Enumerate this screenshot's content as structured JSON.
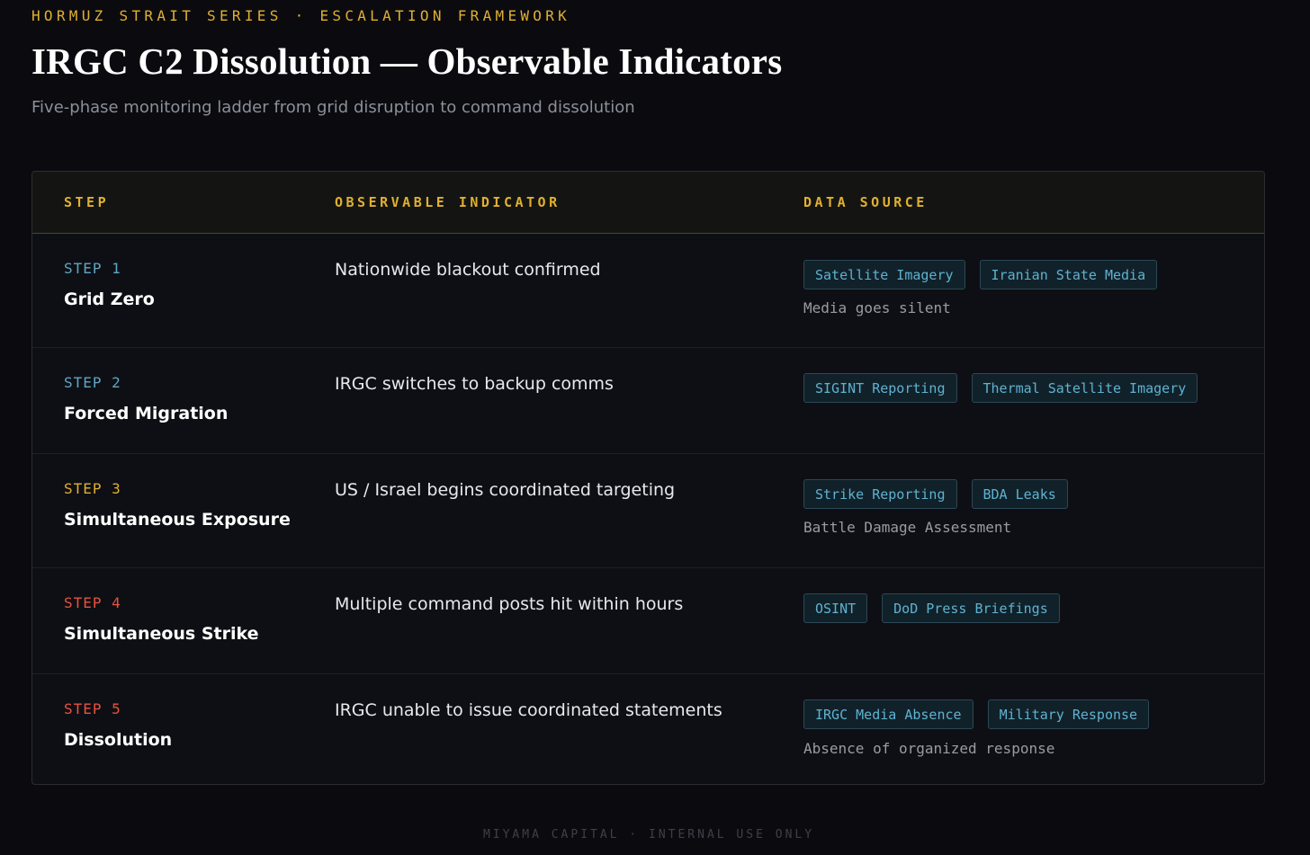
{
  "header": {
    "kicker": "HORMUZ STRAIT SERIES · ESCALATION FRAMEWORK",
    "title": "IRGC C2 Dissolution — Observable Indicators",
    "subtitle": "Five-phase monitoring ladder from grid disruption to command dissolution"
  },
  "table": {
    "columns": [
      "STEP",
      "OBSERVABLE INDICATOR",
      "DATA SOURCE"
    ],
    "rows": [
      {
        "step_label": "STEP 1",
        "step_color": "#5ea7c6",
        "step_name": "Grid Zero",
        "indicator": "Nationwide blackout confirmed",
        "sources": [
          "Satellite Imagery",
          "Iranian State Media"
        ],
        "note": "Media goes silent"
      },
      {
        "step_label": "STEP 2",
        "step_color": "#5ea7c6",
        "step_name": "Forced Migration",
        "indicator": "IRGC switches to backup comms",
        "sources": [
          "SIGINT Reporting",
          "Thermal Satellite Imagery"
        ],
        "note": ""
      },
      {
        "step_label": "STEP 3",
        "step_color": "#e0b030",
        "step_name": "Simultaneous Exposure",
        "indicator": "US / Israel begins coordinated targeting",
        "sources": [
          "Strike Reporting",
          "BDA Leaks"
        ],
        "note": "Battle Damage Assessment"
      },
      {
        "step_label": "STEP 4",
        "step_color": "#e8523f",
        "step_name": "Simultaneous Strike",
        "indicator": "Multiple command posts hit within hours",
        "sources": [
          "OSINT",
          "DoD Press Briefings"
        ],
        "note": ""
      },
      {
        "step_label": "STEP 5",
        "step_color": "#e8523f",
        "step_name": "Dissolution",
        "indicator": "IRGC unable to issue coordinated statements",
        "sources": [
          "IRGC Media Absence",
          "Military Response"
        ],
        "note": "Absence of organized response"
      }
    ]
  },
  "footer": "MIYAMA CAPITAL · INTERNAL USE ONLY"
}
